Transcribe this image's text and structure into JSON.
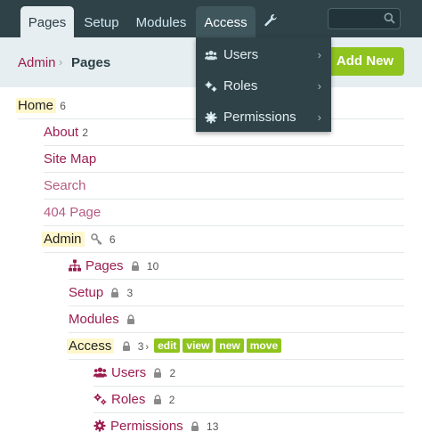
{
  "nav": {
    "tabs": [
      "Pages",
      "Setup",
      "Modules",
      "Access"
    ],
    "wrench_icon": "wrench-icon",
    "search_icon": "search-icon"
  },
  "breadcrumb": {
    "parent": "Admin",
    "separator": "›",
    "current": "Pages"
  },
  "add_new": "Add New",
  "access_menu": {
    "items": [
      {
        "label": "Users",
        "icon": "users-icon"
      },
      {
        "label": "Roles",
        "icon": "roles-icon"
      },
      {
        "label": "Permissions",
        "icon": "gear-icon"
      }
    ],
    "chevron": "›"
  },
  "tree": {
    "home": {
      "label": "Home",
      "count": "6"
    },
    "about": {
      "label": "About",
      "count": "2"
    },
    "sitemap": {
      "label": "Site Map"
    },
    "search": {
      "label": "Search"
    },
    "notfound": {
      "label": "404 Page"
    },
    "admin": {
      "label": "Admin",
      "count": "6"
    },
    "pages": {
      "label": "Pages",
      "count": "10"
    },
    "setup": {
      "label": "Setup",
      "count": "3"
    },
    "modules": {
      "label": "Modules"
    },
    "access": {
      "label": "Access",
      "count": "3",
      "chevron": "›",
      "actions": [
        "edit",
        "view",
        "new",
        "move"
      ]
    },
    "users": {
      "label": "Users",
      "count": "2"
    },
    "roles": {
      "label": "Roles",
      "count": "2"
    },
    "permissions": {
      "label": "Permissions",
      "count": "13"
    }
  },
  "colors": {
    "nav_bg": "#2f4248",
    "accent_green": "#8fc41f",
    "link": "#9b1d4f",
    "crumb_bg": "#e6eef1"
  }
}
